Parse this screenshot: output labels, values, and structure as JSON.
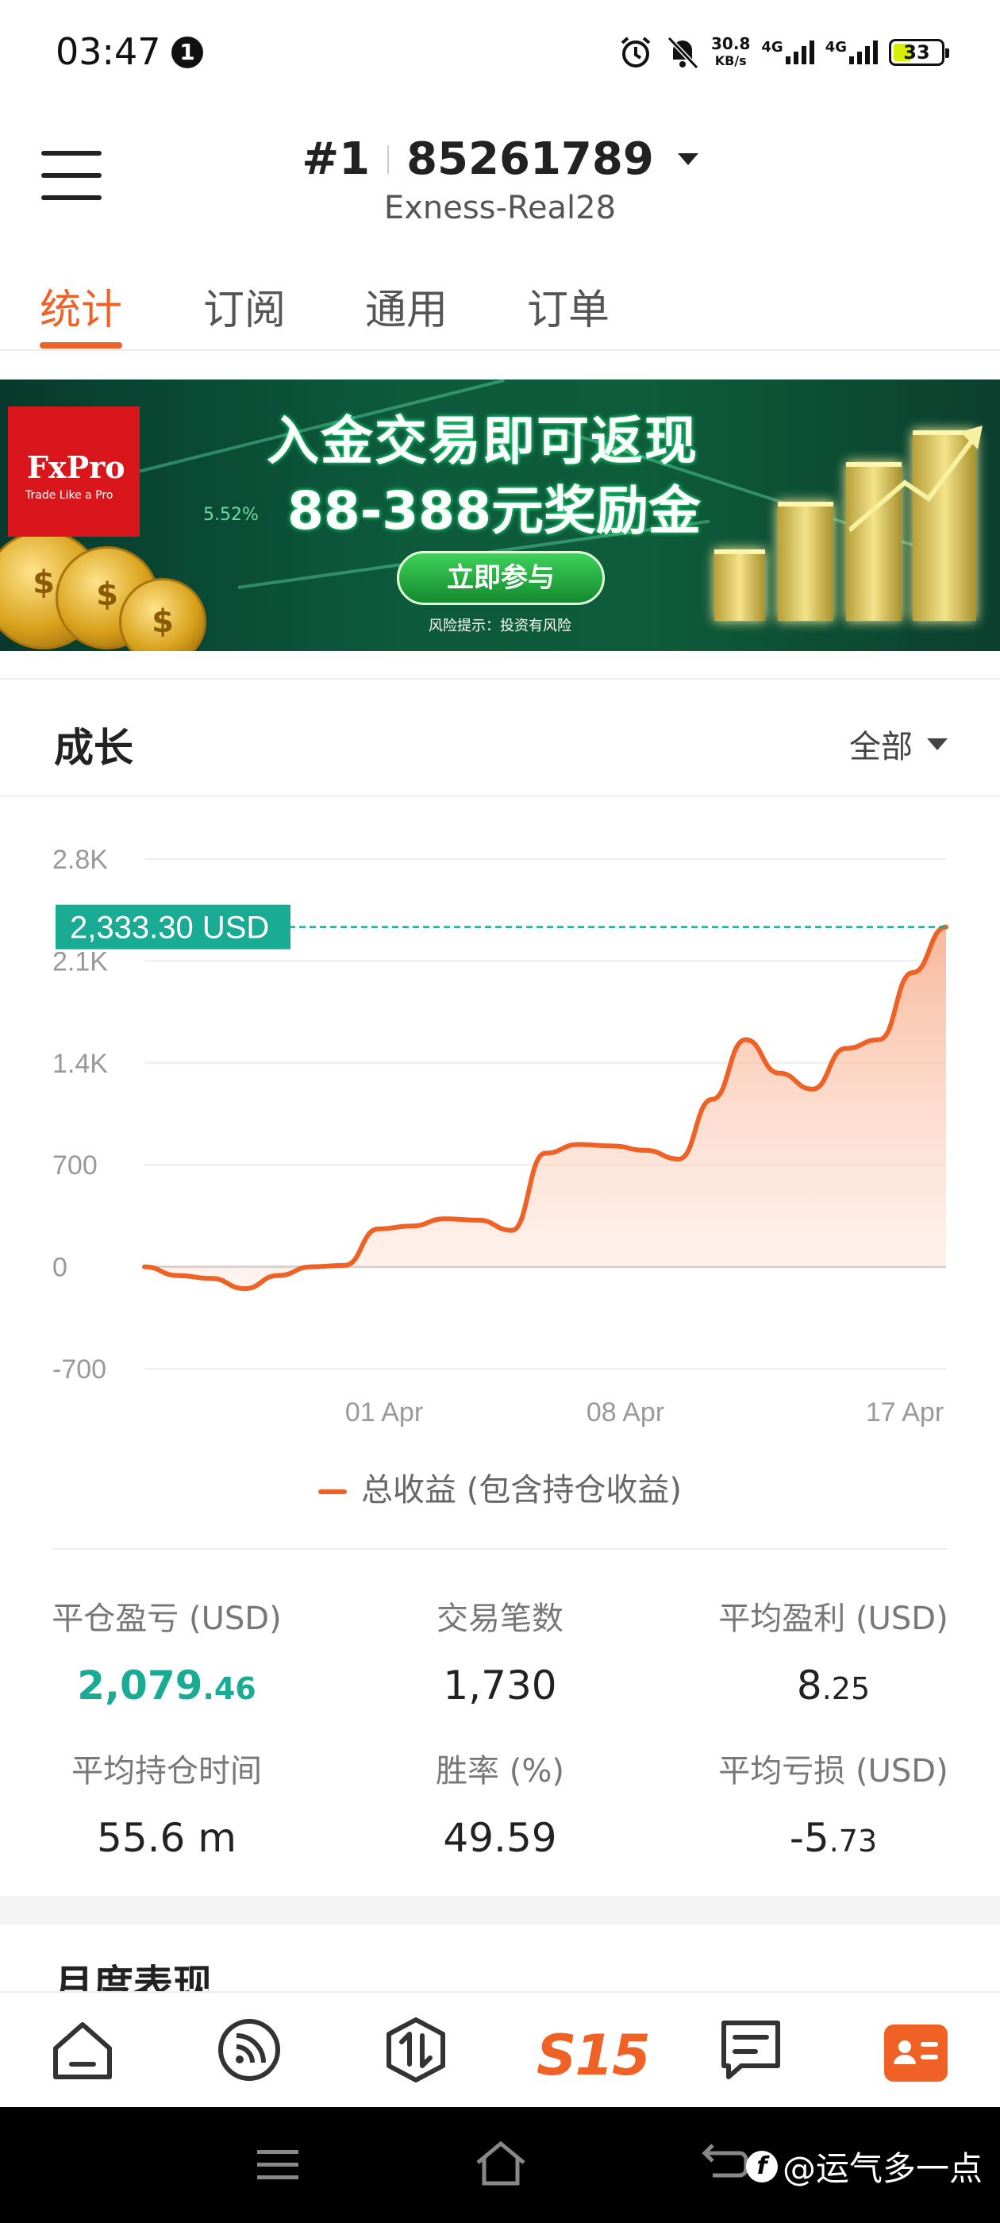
{
  "status_bar": {
    "time": "03:47",
    "notification_count": "1",
    "net_speed_value": "30.8",
    "net_speed_unit": "KB/s",
    "network_1": "4G",
    "network_2": "4G",
    "battery": "33"
  },
  "header": {
    "rank": "#1",
    "account_number": "85261789",
    "server": "Exness-Real28"
  },
  "tabs": [
    {
      "label": "统计",
      "active": true
    },
    {
      "label": "订阅",
      "active": false
    },
    {
      "label": "通用",
      "active": false
    },
    {
      "label": "订单",
      "active": false
    }
  ],
  "banner": {
    "logo_name": "FxPro",
    "logo_tagline": "Trade Like a Pro",
    "percent": "5.52%",
    "headline_1": "入金交易即可返现",
    "headline_2": "88-388元奖励金",
    "cta": "立即参与",
    "risk_note": "风险提示：投资有风险"
  },
  "growth": {
    "title": "成长",
    "filter": "全部",
    "current_value_label": "2,333.30 USD"
  },
  "chart_data": {
    "type": "area",
    "series": [
      {
        "name": "总收益 (包含持仓收益)",
        "color": "#ef6125",
        "values": [
          0,
          -60,
          -80,
          -150,
          -60,
          0,
          10,
          260,
          280,
          330,
          320,
          250,
          780,
          840,
          830,
          800,
          740,
          1150,
          1560,
          1330,
          1220,
          1500,
          1560,
          2020,
          2333.3
        ]
      }
    ],
    "x_tick_labels": [
      "01 Apr",
      "08 Apr",
      "17 Apr"
    ],
    "y_tick_labels": [
      "2.8K",
      "2.1K",
      "1.4K",
      "700",
      "0",
      "-700"
    ],
    "ylim": [
      -700,
      2800
    ],
    "reference_value": 2333.3,
    "grid": true
  },
  "stats": [
    {
      "label": "平仓盈亏 (USD)",
      "value_main": "2,079",
      "value_frac": ".46",
      "highlight": true
    },
    {
      "label": "交易笔数",
      "value_main": "1,730",
      "value_frac": "",
      "highlight": false
    },
    {
      "label": "平均盈利 (USD)",
      "value_main": "8",
      "value_frac": ".25",
      "highlight": false
    },
    {
      "label": "平均持仓时间",
      "value_main": "55.6 m",
      "value_frac": "",
      "highlight": false
    },
    {
      "label": "胜率 (%)",
      "value_main": "49.59",
      "value_frac": "",
      "highlight": false
    },
    {
      "label": "平均亏损 (USD)",
      "value_main": "-5",
      "value_frac": ".73",
      "highlight": false
    }
  ],
  "monthly_title": "月度表现",
  "bottom_nav": {
    "items": [
      "home-icon",
      "feed-icon",
      "trade-icon",
      "s15-logo",
      "chat-icon",
      "profile-icon"
    ],
    "s15_label": "S15",
    "active_color": "#ef6125"
  },
  "watermark": {
    "logo": "f",
    "text": "@运气多一点"
  }
}
